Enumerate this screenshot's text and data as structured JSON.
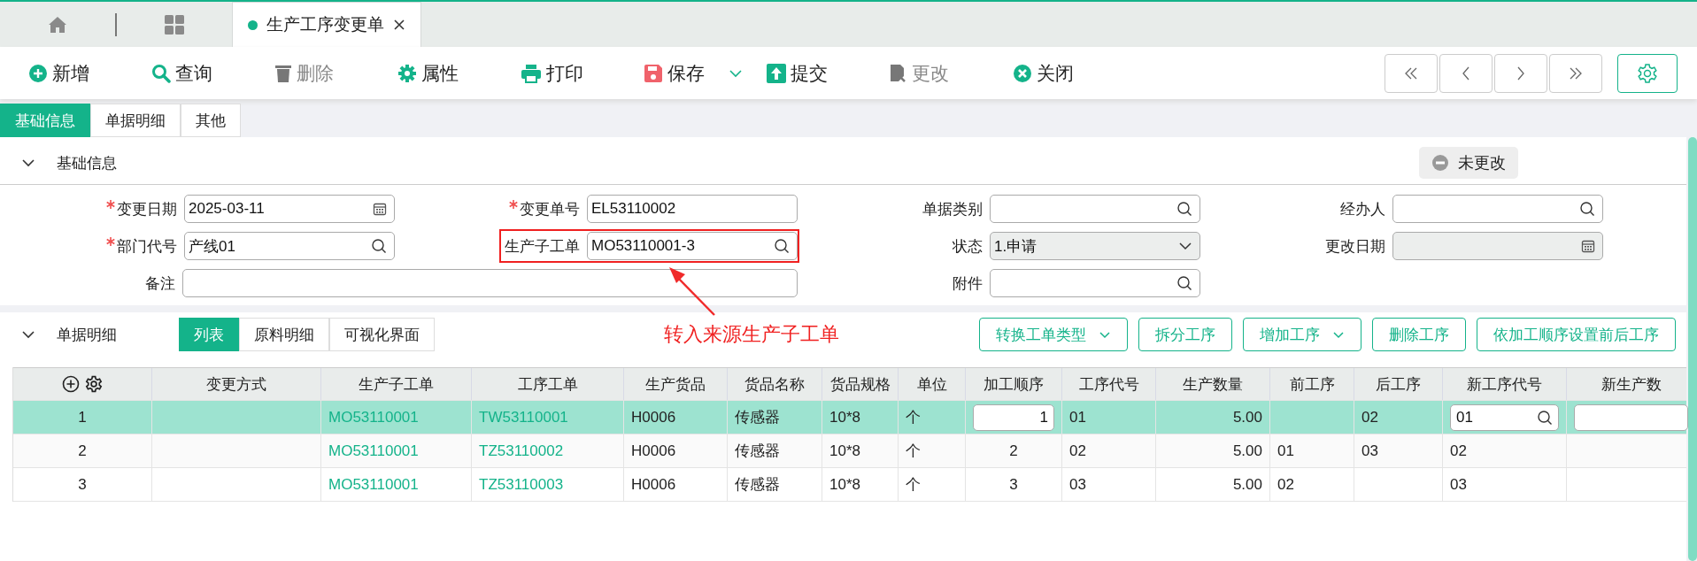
{
  "window_tabs": [
    {
      "kind": "home",
      "selected": false
    },
    {
      "kind": "apps",
      "selected": false
    },
    {
      "kind": "doc",
      "label": "生产工序变更单",
      "selected": true
    }
  ],
  "toolbar": [
    {
      "kind": "add",
      "label": "新增",
      "disabled": false
    },
    {
      "kind": "search",
      "label": "查询",
      "disabled": false
    },
    {
      "kind": "delete",
      "label": "删除",
      "disabled": true
    },
    {
      "kind": "properties",
      "label": "属性",
      "disabled": false
    },
    {
      "kind": "print",
      "label": "打印",
      "disabled": false
    },
    {
      "kind": "save",
      "label": "保存",
      "disabled": false,
      "dropdown": true
    },
    {
      "kind": "submit",
      "label": "提交",
      "disabled": false
    },
    {
      "kind": "modify",
      "label": "更改",
      "disabled": true
    },
    {
      "kind": "close",
      "label": "关闭",
      "disabled": false
    }
  ],
  "section_tabs": [
    {
      "label": "基础信息",
      "selected": true
    },
    {
      "label": "单据明细",
      "selected": false
    },
    {
      "label": "其他",
      "selected": false
    }
  ],
  "basic_info": {
    "title": "基础信息",
    "expanded": true,
    "status_badge": "未更改",
    "fields": [
      {
        "label": "变更日期",
        "kind": "date",
        "value": "2025-03-11",
        "required": true,
        "disabled": false
      },
      {
        "label": "变更单号",
        "kind": "text",
        "value": "EL53110002",
        "required": true,
        "disabled": false
      },
      {
        "label": "单据类别",
        "kind": "lookup",
        "required": false,
        "disabled": false
      },
      {
        "label": "经办人",
        "kind": "lookup",
        "required": false,
        "disabled": false
      },
      {
        "label": "部门代号",
        "kind": "lookup",
        "value": "产线01",
        "required": true,
        "disabled": false
      },
      {
        "label": "生产子工单",
        "kind": "lookup",
        "value": "MO53110001-3",
        "required": false,
        "disabled": false,
        "highlighted": true
      },
      {
        "label": "状态",
        "kind": "select",
        "value": "1.申请",
        "required": false,
        "disabled": true
      },
      {
        "label": "更改日期",
        "kind": "date",
        "required": false,
        "disabled": true
      },
      {
        "label": "备注",
        "kind": "text",
        "required": false,
        "disabled": false,
        "wide": true
      },
      {
        "label": "附件",
        "kind": "lookup",
        "required": false,
        "disabled": false
      }
    ]
  },
  "annotation": {
    "text": "转入来源生产子工单"
  },
  "detail": {
    "title": "单据明细",
    "expanded": true,
    "view_tabs": [
      {
        "label": "列表",
        "selected": true
      },
      {
        "label": "原料明细",
        "selected": false
      },
      {
        "label": "可视化界面",
        "selected": false
      }
    ],
    "actions": [
      {
        "label": "转换工单类型",
        "dropdown": true
      },
      {
        "label": "拆分工序",
        "dropdown": false
      },
      {
        "label": "增加工序",
        "dropdown": true
      },
      {
        "label": "删除工序",
        "dropdown": false
      },
      {
        "label": "依加工顺序设置前后工序",
        "dropdown": false
      }
    ],
    "table": {
      "columns": [
        {
          "kind": "index"
        },
        {
          "label": "变更方式",
          "kind": "text"
        },
        {
          "label": "生产子工单",
          "kind": "link"
        },
        {
          "label": "工序工单",
          "kind": "link"
        },
        {
          "label": "生产货品",
          "kind": "text"
        },
        {
          "label": "货品名称",
          "kind": "text"
        },
        {
          "label": "货品规格",
          "kind": "text"
        },
        {
          "label": "单位",
          "kind": "text"
        },
        {
          "label": "加工顺序",
          "kind": "center",
          "editable": true
        },
        {
          "label": "工序代号",
          "kind": "text"
        },
        {
          "label": "生产数量",
          "kind": "number"
        },
        {
          "label": "前工序",
          "kind": "text"
        },
        {
          "label": "后工序",
          "kind": "text"
        },
        {
          "label": "新工序代号",
          "kind": "lookup",
          "editable": true
        },
        {
          "label": "新生产数",
          "kind": "text",
          "editable": true
        }
      ],
      "rows": [
        {
          "selected": true,
          "cells": [
            "1",
            "",
            "MO53110001",
            "TW53110001",
            "H0006",
            "传感器",
            "10*8",
            "个",
            "1",
            "01",
            "5.00",
            "",
            "02",
            "01",
            ""
          ]
        },
        {
          "selected": false,
          "cells": [
            "2",
            "",
            "MO53110001",
            "TZ53110002",
            "H0006",
            "传感器",
            "10*8",
            "个",
            "2",
            "02",
            "5.00",
            "01",
            "03",
            "02",
            ""
          ]
        },
        {
          "selected": false,
          "cells": [
            "3",
            "",
            "MO53110001",
            "TZ53110003",
            "H0006",
            "传感器",
            "10*8",
            "个",
            "3",
            "03",
            "5.00",
            "02",
            "",
            "03",
            ""
          ]
        }
      ]
    }
  }
}
